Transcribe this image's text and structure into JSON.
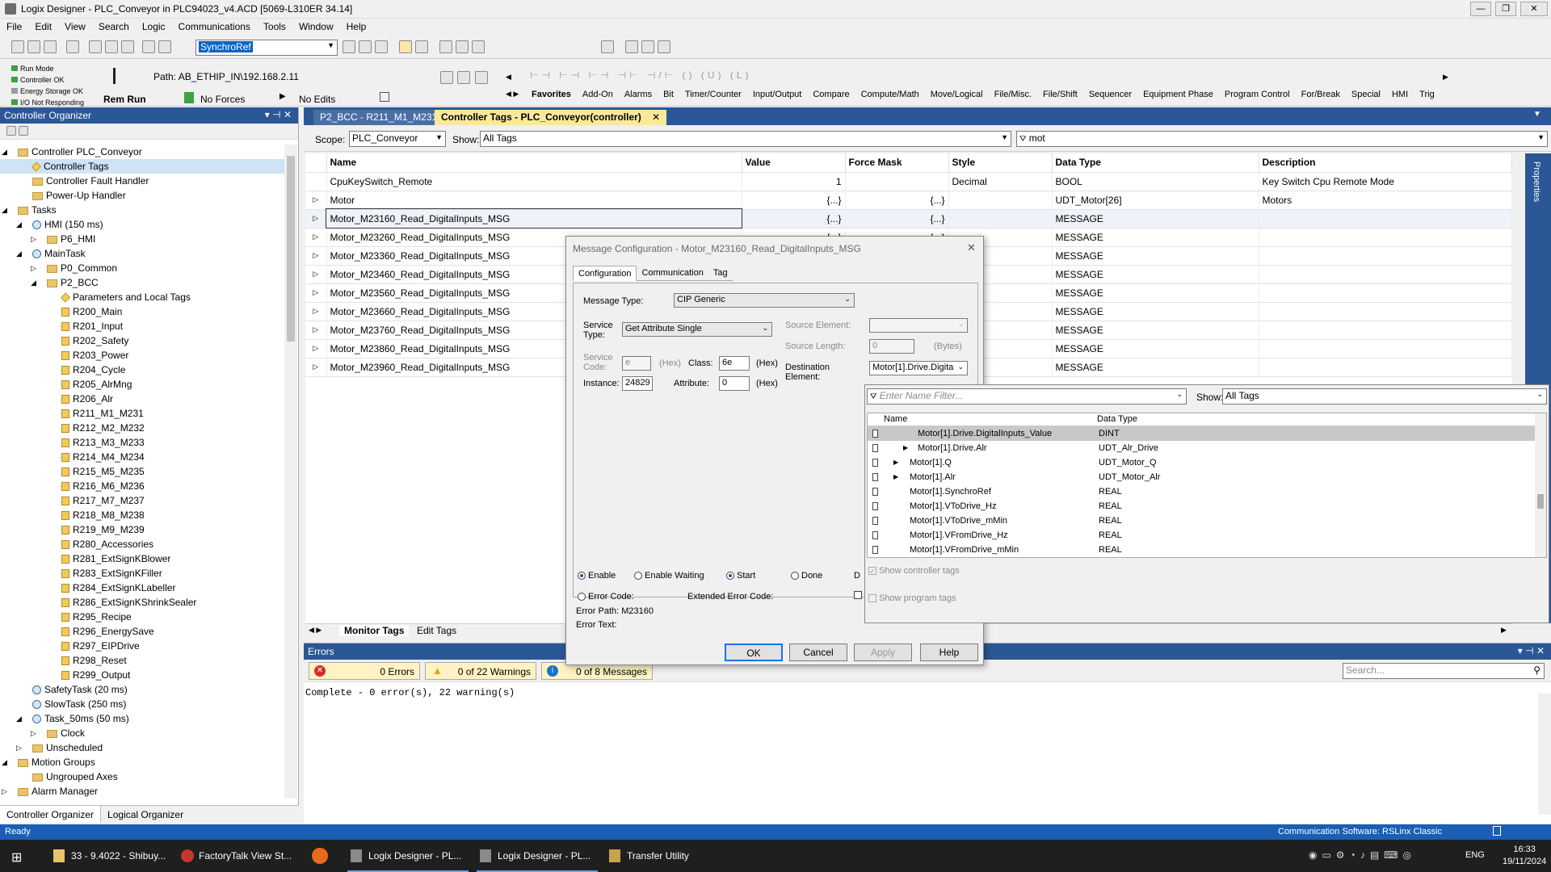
{
  "window": {
    "title": "Logix Designer - PLC_Conveyor in PLC94023_v4.ACD [5069-L310ER 34.14]"
  },
  "menu": [
    "File",
    "Edit",
    "View",
    "Search",
    "Logic",
    "Communications",
    "Tools",
    "Window",
    "Help"
  ],
  "toolbar": {
    "search_value": "SynchroRef",
    "path_label": "Path:",
    "path_value": "AB_ETHIP_IN\\192.168.2.11"
  },
  "status": {
    "run_mode": "Run Mode",
    "controller_ok": "Controller OK",
    "energy": "Energy Storage OK",
    "io": "I/O Not Responding",
    "rem_run": "Rem Run",
    "forces": "No Forces",
    "edits": "No Edits"
  },
  "palette": [
    "Favorites",
    "Add-On",
    "Alarms",
    "Bit",
    "Timer/Counter",
    "Input/Output",
    "Compare",
    "Compute/Math",
    "Move/Logical",
    "File/Misc.",
    "File/Shift",
    "Sequencer",
    "Equipment Phase",
    "Program Control",
    "For/Break",
    "Special",
    "HMI",
    "Trig"
  ],
  "organizer": {
    "title": "Controller Organizer",
    "tabs": [
      "Controller Organizer",
      "Logical Organizer"
    ],
    "tree": [
      {
        "t": "Controller PLC_Conveyor",
        "i": 0,
        "k": "folder",
        "e": "◢"
      },
      {
        "t": "Controller Tags",
        "i": 1,
        "k": "tag",
        "sel": true
      },
      {
        "t": "Controller Fault Handler",
        "i": 1,
        "k": "folder"
      },
      {
        "t": "Power-Up Handler",
        "i": 1,
        "k": "folder"
      },
      {
        "t": "Tasks",
        "i": 0,
        "k": "folder",
        "e": "◢"
      },
      {
        "t": "HMI (150 ms)",
        "i": 1,
        "k": "clock",
        "e": "◢"
      },
      {
        "t": "P6_HMI",
        "i": 2,
        "k": "folder",
        "e": "▷"
      },
      {
        "t": "MainTask",
        "i": 1,
        "k": "clock",
        "e": "◢"
      },
      {
        "t": "P0_Common",
        "i": 2,
        "k": "folder",
        "e": "▷"
      },
      {
        "t": "P2_BCC",
        "i": 2,
        "k": "folder",
        "e": "◢"
      },
      {
        "t": "Parameters and Local Tags",
        "i": 3,
        "k": "tag"
      },
      {
        "t": "R200_Main",
        "i": 3,
        "k": "rout"
      },
      {
        "t": "R201_Input",
        "i": 3,
        "k": "rout"
      },
      {
        "t": "R202_Safety",
        "i": 3,
        "k": "rout"
      },
      {
        "t": "R203_Power",
        "i": 3,
        "k": "rout"
      },
      {
        "t": "R204_Cycle",
        "i": 3,
        "k": "rout"
      },
      {
        "t": "R205_AlrMng",
        "i": 3,
        "k": "rout"
      },
      {
        "t": "R206_Alr",
        "i": 3,
        "k": "rout"
      },
      {
        "t": "R211_M1_M231",
        "i": 3,
        "k": "rout"
      },
      {
        "t": "R212_M2_M232",
        "i": 3,
        "k": "rout"
      },
      {
        "t": "R213_M3_M233",
        "i": 3,
        "k": "rout"
      },
      {
        "t": "R214_M4_M234",
        "i": 3,
        "k": "rout"
      },
      {
        "t": "R215_M5_M235",
        "i": 3,
        "k": "rout"
      },
      {
        "t": "R216_M6_M236",
        "i": 3,
        "k": "rout"
      },
      {
        "t": "R217_M7_M237",
        "i": 3,
        "k": "rout"
      },
      {
        "t": "R218_M8_M238",
        "i": 3,
        "k": "rout"
      },
      {
        "t": "R219_M9_M239",
        "i": 3,
        "k": "rout"
      },
      {
        "t": "R280_Accessories",
        "i": 3,
        "k": "rout"
      },
      {
        "t": "R281_ExtSignKBlower",
        "i": 3,
        "k": "rout"
      },
      {
        "t": "R283_ExtSignKFiller",
        "i": 3,
        "k": "rout"
      },
      {
        "t": "R284_ExtSignKLabeller",
        "i": 3,
        "k": "rout"
      },
      {
        "t": "R286_ExtSignKShrinkSealer",
        "i": 3,
        "k": "rout"
      },
      {
        "t": "R295_Recipe",
        "i": 3,
        "k": "rout"
      },
      {
        "t": "R296_EnergySave",
        "i": 3,
        "k": "rout"
      },
      {
        "t": "R297_EIPDrive",
        "i": 3,
        "k": "rout"
      },
      {
        "t": "R298_Reset",
        "i": 3,
        "k": "rout"
      },
      {
        "t": "R299_Output",
        "i": 3,
        "k": "rout"
      },
      {
        "t": "SafetyTask (20 ms)",
        "i": 1,
        "k": "clock"
      },
      {
        "t": "SlowTask (250 ms)",
        "i": 1,
        "k": "clock"
      },
      {
        "t": "Task_50ms (50 ms)",
        "i": 1,
        "k": "clock",
        "e": "◢"
      },
      {
        "t": "Clock",
        "i": 2,
        "k": "folder",
        "e": "▷"
      },
      {
        "t": "Unscheduled",
        "i": 1,
        "k": "folder",
        "e": "▷"
      },
      {
        "t": "Motion Groups",
        "i": 0,
        "k": "folder",
        "e": "◢"
      },
      {
        "t": "Ungrouped Axes",
        "i": 1,
        "k": "folder"
      },
      {
        "t": "Alarm Manager",
        "i": 0,
        "k": "folder",
        "e": "▷"
      }
    ]
  },
  "tabs": {
    "inactive": "P2_BCC - R211_M1_M231",
    "active": "Controller Tags - PLC_Conveyor(controller)"
  },
  "tagview": {
    "scope_label": "Scope:",
    "scope_value": "PLC_Conveyor",
    "show_label": "Show:",
    "show_value": "All Tags",
    "filter": "mot",
    "columns": [
      "Name",
      "Value",
      "Force Mask",
      "Style",
      "Data Type",
      "Description"
    ],
    "rows": [
      {
        "name": "CpuKeySwitch_Remote",
        "value": "1",
        "force": "",
        "style": "Decimal",
        "type": "BOOL",
        "desc": "Key Switch Cpu Remote Mode"
      },
      {
        "name": "Motor",
        "value": "{...}",
        "force": "{...}",
        "style": "",
        "type": "UDT_Motor[26]",
        "desc": "Motors"
      },
      {
        "name": "Motor_M23160_Read_DigitalInputs_MSG",
        "value": "{...}",
        "force": "{...}",
        "style": "",
        "type": "MESSAGE",
        "desc": ""
      },
      {
        "name": "Motor_M23260_Read_DigitalInputs_MSG",
        "value": "{...}",
        "force": "{...}",
        "style": "",
        "type": "MESSAGE",
        "desc": ""
      },
      {
        "name": "Motor_M23360_Read_DigitalInputs_MSG",
        "value": "",
        "force": "",
        "style": "",
        "type": "MESSAGE",
        "desc": ""
      },
      {
        "name": "Motor_M23460_Read_DigitalInputs_MSG",
        "value": "",
        "force": "",
        "style": "",
        "type": "MESSAGE",
        "desc": ""
      },
      {
        "name": "Motor_M23560_Read_DigitalInputs_MSG",
        "value": "",
        "force": "",
        "style": "",
        "type": "MESSAGE",
        "desc": ""
      },
      {
        "name": "Motor_M23660_Read_DigitalInputs_MSG",
        "value": "",
        "force": "",
        "style": "",
        "type": "MESSAGE",
        "desc": ""
      },
      {
        "name": "Motor_M23760_Read_DigitalInputs_MSG",
        "value": "",
        "force": "",
        "style": "",
        "type": "MESSAGE",
        "desc": ""
      },
      {
        "name": "Motor_M23860_Read_DigitalInputs_MSG",
        "value": "",
        "force": "",
        "style": "",
        "type": "MESSAGE",
        "desc": ""
      },
      {
        "name": "Motor_M23960_Read_DigitalInputs_MSG",
        "value": "",
        "force": "",
        "style": "",
        "type": "MESSAGE",
        "desc": ""
      }
    ],
    "bottom_tabs": [
      "Monitor Tags",
      "Edit Tags"
    ]
  },
  "dialog": {
    "title": "Message Configuration - Motor_M23160_Read_DigitalInputs_MSG",
    "tabs": [
      "Configuration",
      "Communication",
      "Tag"
    ],
    "msg_type_label": "Message Type:",
    "msg_type": "CIP Generic",
    "service_type_label": "Service\nType:",
    "service_type": "Get Attribute Single",
    "service_code_label": "Service\nCode:",
    "service_code": "e",
    "hex": "(Hex)",
    "class_label": "Class:",
    "class_value": "6e",
    "instance_label": "Instance:",
    "instance_value": "24829",
    "attribute_label": "Attribute:",
    "attribute_value": "0",
    "source_element_label": "Source Element:",
    "source_length_label": "Source Length:",
    "source_length": "0",
    "bytes": "(Bytes)",
    "dest_label": "Destination\nElement:",
    "dest_value": "Motor[1].Drive.Digita",
    "enable": "Enable",
    "enable_waiting": "Enable Waiting",
    "start": "Start",
    "done": "Done",
    "dn_cut": "D",
    "error_code": "Error Code:",
    "ext_error_code": "Extended Error Code:",
    "error_path": "Error Path:  M23160",
    "error_text": "Error Text:",
    "ok": "OK",
    "cancel": "Cancel",
    "apply": "Apply",
    "help": "Help"
  },
  "browser": {
    "filter_placeholder": "Enter Name Filter...",
    "show_label": "Show:",
    "show_value": "All Tags",
    "col_name": "Name",
    "col_type": "Data Type",
    "rows": [
      {
        "n": "Motor[1].Drive.DigitalInputs_Value",
        "t": "DINT",
        "ind": 3,
        "exp": "",
        "sel": true
      },
      {
        "n": "Motor[1].Drive.Alr",
        "t": "UDT_Alr_Drive",
        "ind": 3,
        "exp": "▶"
      },
      {
        "n": "Motor[1].Q",
        "t": "UDT_Motor_Q",
        "ind": 2,
        "exp": "▶"
      },
      {
        "n": "Motor[1].Alr",
        "t": "UDT_Motor_Alr",
        "ind": 2,
        "exp": "▶"
      },
      {
        "n": "Motor[1].SynchroRef",
        "t": "REAL",
        "ind": 2,
        "exp": ""
      },
      {
        "n": "Motor[1].VToDrive_Hz",
        "t": "REAL",
        "ind": 2,
        "exp": ""
      },
      {
        "n": "Motor[1].VToDrive_mMin",
        "t": "REAL",
        "ind": 2,
        "exp": ""
      },
      {
        "n": "Motor[1].VFromDrive_Hz",
        "t": "REAL",
        "ind": 2,
        "exp": ""
      },
      {
        "n": "Motor[1].VFromDrive_mMin",
        "t": "REAL",
        "ind": 2,
        "exp": ""
      }
    ],
    "show_controller": "Show controller tags",
    "show_program": "Show program tags"
  },
  "errors": {
    "title": "Errors",
    "errors": "0 Errors",
    "warnings": "0 of 22 Warnings",
    "messages": "0 of 8 Messages",
    "search": "Search...",
    "text": "Complete - 0 error(s), 22 warning(s)"
  },
  "statusbar": {
    "left": "Ready",
    "right": "Communication Software: RSLinx Classic"
  },
  "taskbar": {
    "apps": [
      "33 - 9.4022 - Shibuy...",
      "FactoryTalk View St...",
      "",
      "Logix Designer - PL...",
      "Logix Designer - PL...",
      "Transfer Utility"
    ],
    "lang": "ENG",
    "time": "16:33",
    "date": "19/11/2024"
  }
}
